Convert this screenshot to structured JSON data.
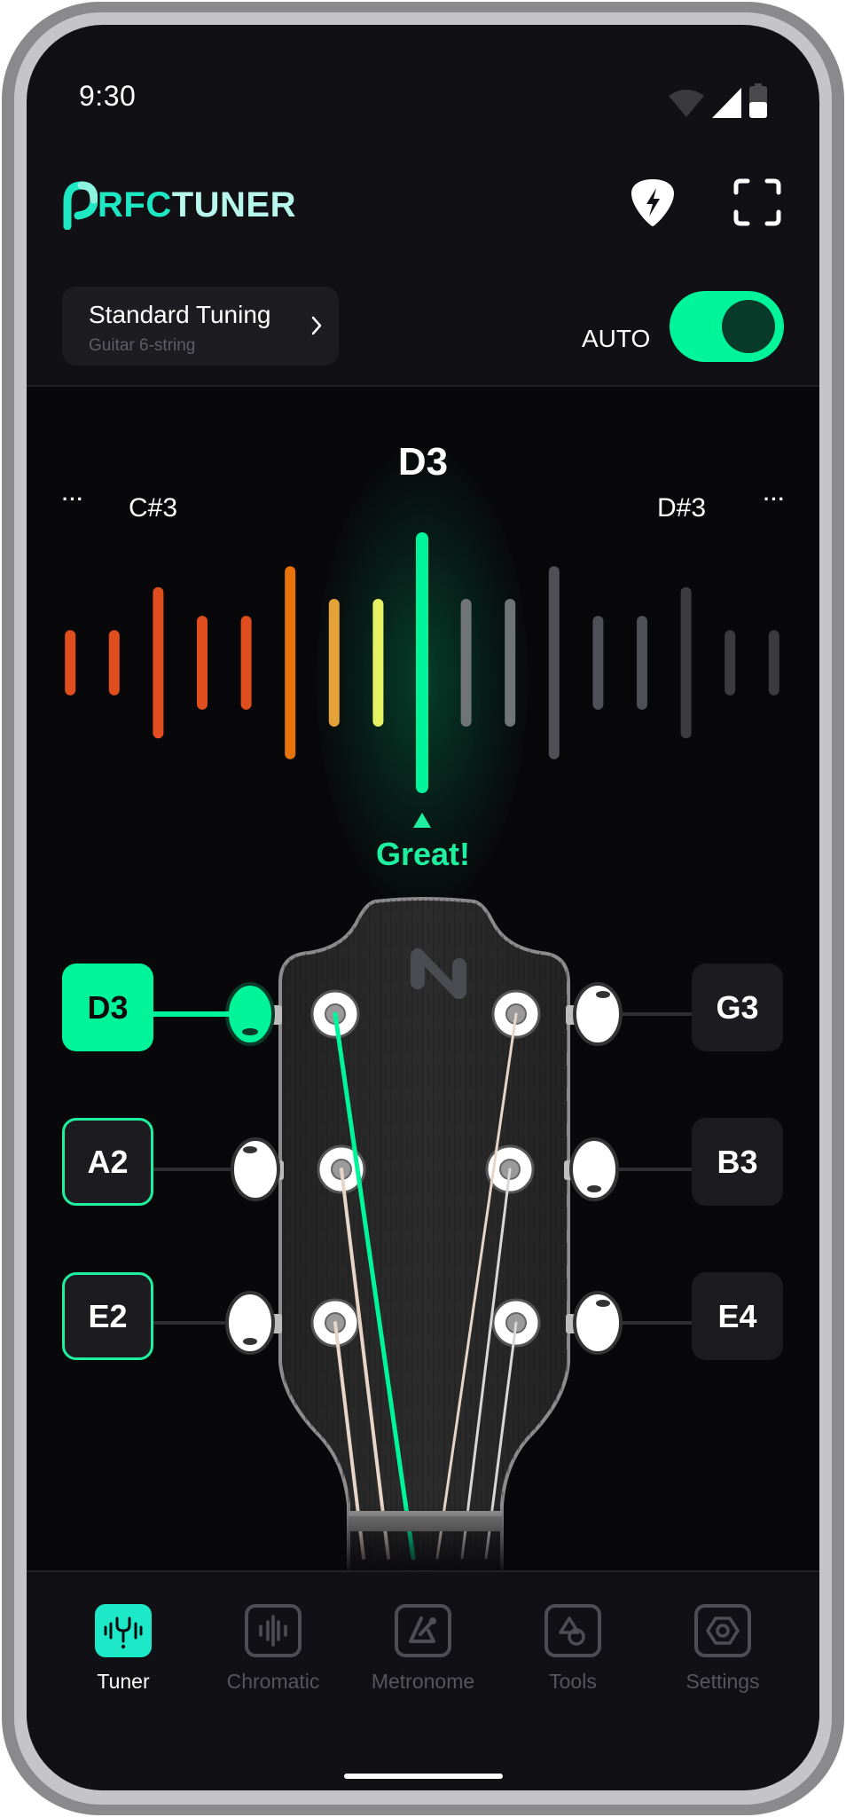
{
  "status_bar": {
    "time": "9:30",
    "icons": [
      "wifi-icon",
      "signal-icon",
      "battery-icon"
    ],
    "battery_level": 0.5
  },
  "header": {
    "logo": {
      "glyph": "P",
      "rfc": "RFC",
      "tuner": "TUNER"
    },
    "actions": [
      {
        "name": "pick-boost-button",
        "icon": "guitar-pick-lightning-icon"
      },
      {
        "name": "fullscreen-button",
        "icon": "scan-frame-icon"
      }
    ]
  },
  "tuning": {
    "title": "Standard Tuning",
    "subtitle": "Guitar 6-string",
    "chevron": "›"
  },
  "auto_mode": {
    "label": "AUTO",
    "enabled": true
  },
  "tuner": {
    "current_note": "D3",
    "prev_note": "C#3",
    "next_note": "D#3",
    "more_left": "···",
    "more_right": "···",
    "status": "Great!",
    "meter": {
      "center_index": 8,
      "bars": [
        {
          "level": 0.25,
          "color": "#e04e1f"
        },
        {
          "level": 0.25,
          "color": "#e04e1f"
        },
        {
          "level": 0.58,
          "color": "#e04e1f"
        },
        {
          "level": 0.36,
          "color": "#e04e1f"
        },
        {
          "level": 0.36,
          "color": "#e04e1f"
        },
        {
          "level": 0.74,
          "color": "#e8730a"
        },
        {
          "level": 0.49,
          "color": "#e6a23a"
        },
        {
          "level": 0.49,
          "color": "#e4f264"
        },
        {
          "level": 1.0,
          "color": "#00f59a"
        },
        {
          "level": 0.49,
          "color": "#6f7577"
        },
        {
          "level": 0.49,
          "color": "#6f7577"
        },
        {
          "level": 0.74,
          "color": "#4f4f57"
        },
        {
          "level": 0.36,
          "color": "#4f4f57"
        },
        {
          "level": 0.36,
          "color": "#4f4f57"
        },
        {
          "level": 0.58,
          "color": "#3c3c3f"
        },
        {
          "level": 0.25,
          "color": "#3c3c3f"
        },
        {
          "level": 0.25,
          "color": "#3c3c3f"
        }
      ]
    }
  },
  "strings": {
    "left": [
      {
        "note": "D3",
        "state": "active"
      },
      {
        "note": "A2",
        "state": "tuned"
      },
      {
        "note": "E2",
        "state": "tuned"
      }
    ],
    "right": [
      {
        "note": "G3",
        "state": "idle"
      },
      {
        "note": "B3",
        "state": "idle"
      },
      {
        "note": "E4",
        "state": "idle"
      }
    ]
  },
  "colors": {
    "accent": "#00f59a",
    "accent_text": "#1ef0a0",
    "logo_teal": "#1ee8c4",
    "logo_mint": "#b8f7ec",
    "active_tab": "#1de9c8",
    "inactive": "#55555b"
  },
  "nav": {
    "items": [
      {
        "label": "Tuner",
        "icon": "tuning-fork-icon",
        "active": true
      },
      {
        "label": "Chromatic",
        "icon": "waveform-icon",
        "active": false
      },
      {
        "label": "Metronome",
        "icon": "metronome-icon",
        "active": false
      },
      {
        "label": "Tools",
        "icon": "shapes-icon",
        "active": false
      },
      {
        "label": "Settings",
        "icon": "hex-nut-icon",
        "active": false
      }
    ]
  }
}
